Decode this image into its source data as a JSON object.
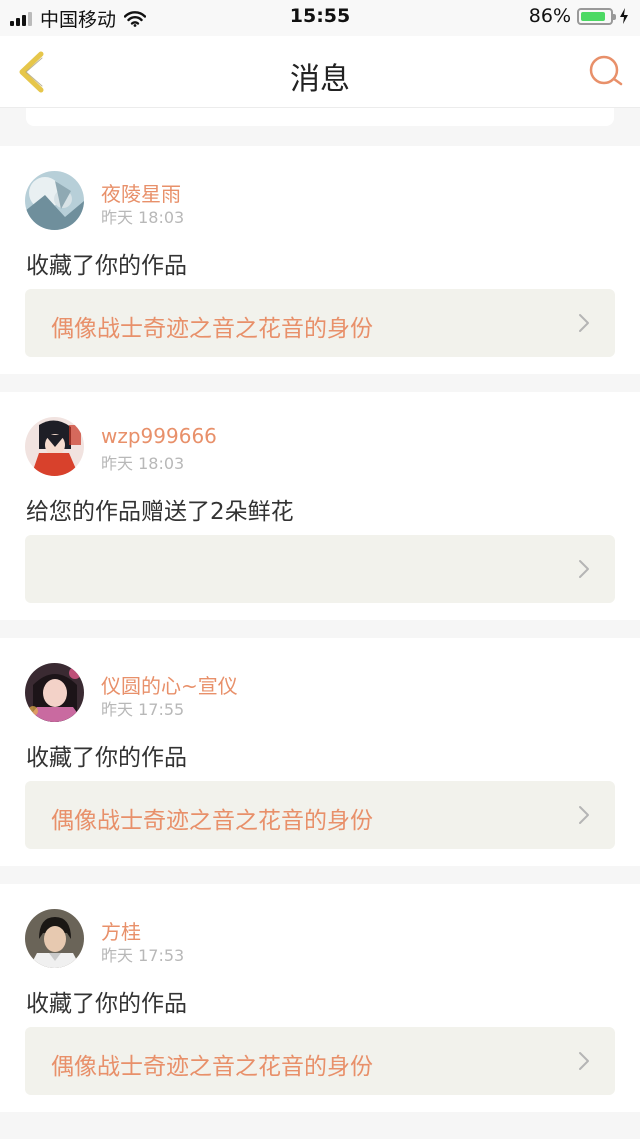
{
  "status_bar": {
    "carrier": "中国移动",
    "time": "15:55",
    "battery": "86%",
    "battery_level": 0.86
  },
  "nav": {
    "title": "消息",
    "back_icon": "chevron-left-icon",
    "search_icon": "search-icon"
  },
  "colors": {
    "accent": "#e8906a",
    "back_icon": "#e6c64a",
    "card_link_bg": "#f2f2ec",
    "page_bg": "#f6f6f6"
  },
  "messages": [
    {
      "user": "夜陵星雨",
      "time": "昨天 18:03",
      "action": "收藏了你的作品",
      "work": "偶像战士奇迹之音之花音的身份"
    },
    {
      "user": "wzp999666",
      "time": "昨天 18:03",
      "action": "给您的作品赠送了2朵鲜花",
      "work": ""
    },
    {
      "user": "仪圆的心~宣仪",
      "time": "昨天 17:55",
      "action": "收藏了你的作品",
      "work": "偶像战士奇迹之音之花音的身份"
    },
    {
      "user": "方桂",
      "time": "昨天 17:53",
      "action": "收藏了你的作品",
      "work": "偶像战士奇迹之音之花音的身份"
    }
  ]
}
